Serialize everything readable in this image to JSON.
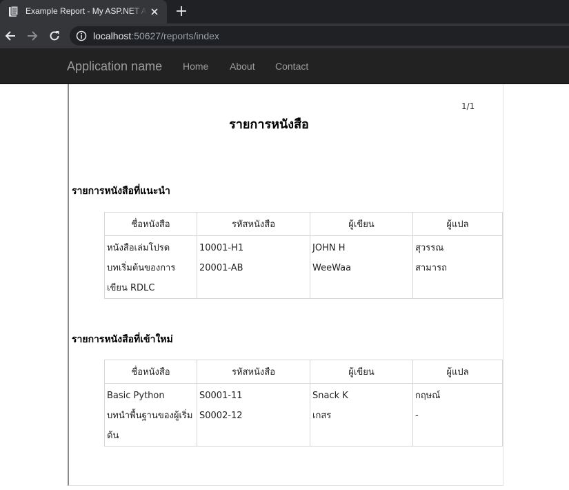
{
  "browser": {
    "tab_title": "Example Report - My ASP.NET Application",
    "url_host": "localhost",
    "url_rest": ":50627/reports/index"
  },
  "navbar": {
    "brand": "Application name",
    "links": [
      "Home",
      "About",
      "Contact"
    ]
  },
  "report": {
    "page_number": "1/1",
    "title": "รายการหนังสือ",
    "columns": [
      "ชื่อหนังสือ",
      "รหัสหนังสือ",
      "ผู้เขียน",
      "ผู้แปล"
    ],
    "sections": [
      {
        "title": "รายการหนังสือที่แนะนำ",
        "rows": [
          [
            "หนังสือเล่มโปรด",
            "10001-H1",
            "JOHN H",
            "สุวรรณ"
          ],
          [
            "บทเริ่มต้นของการเขียน RDLC",
            "20001-AB",
            "WeeWaa",
            "สามารถ"
          ]
        ]
      },
      {
        "title": "รายการหนังสือที่เข้าใหม่",
        "rows": [
          [
            "Basic Python",
            "S0001-11",
            "Snack K",
            "กฤษณ์"
          ],
          [
            "บทนำพื้นฐานของผู้เริ่มต้น",
            "S0002-12",
            "เกสร",
            "-"
          ]
        ]
      }
    ]
  }
}
